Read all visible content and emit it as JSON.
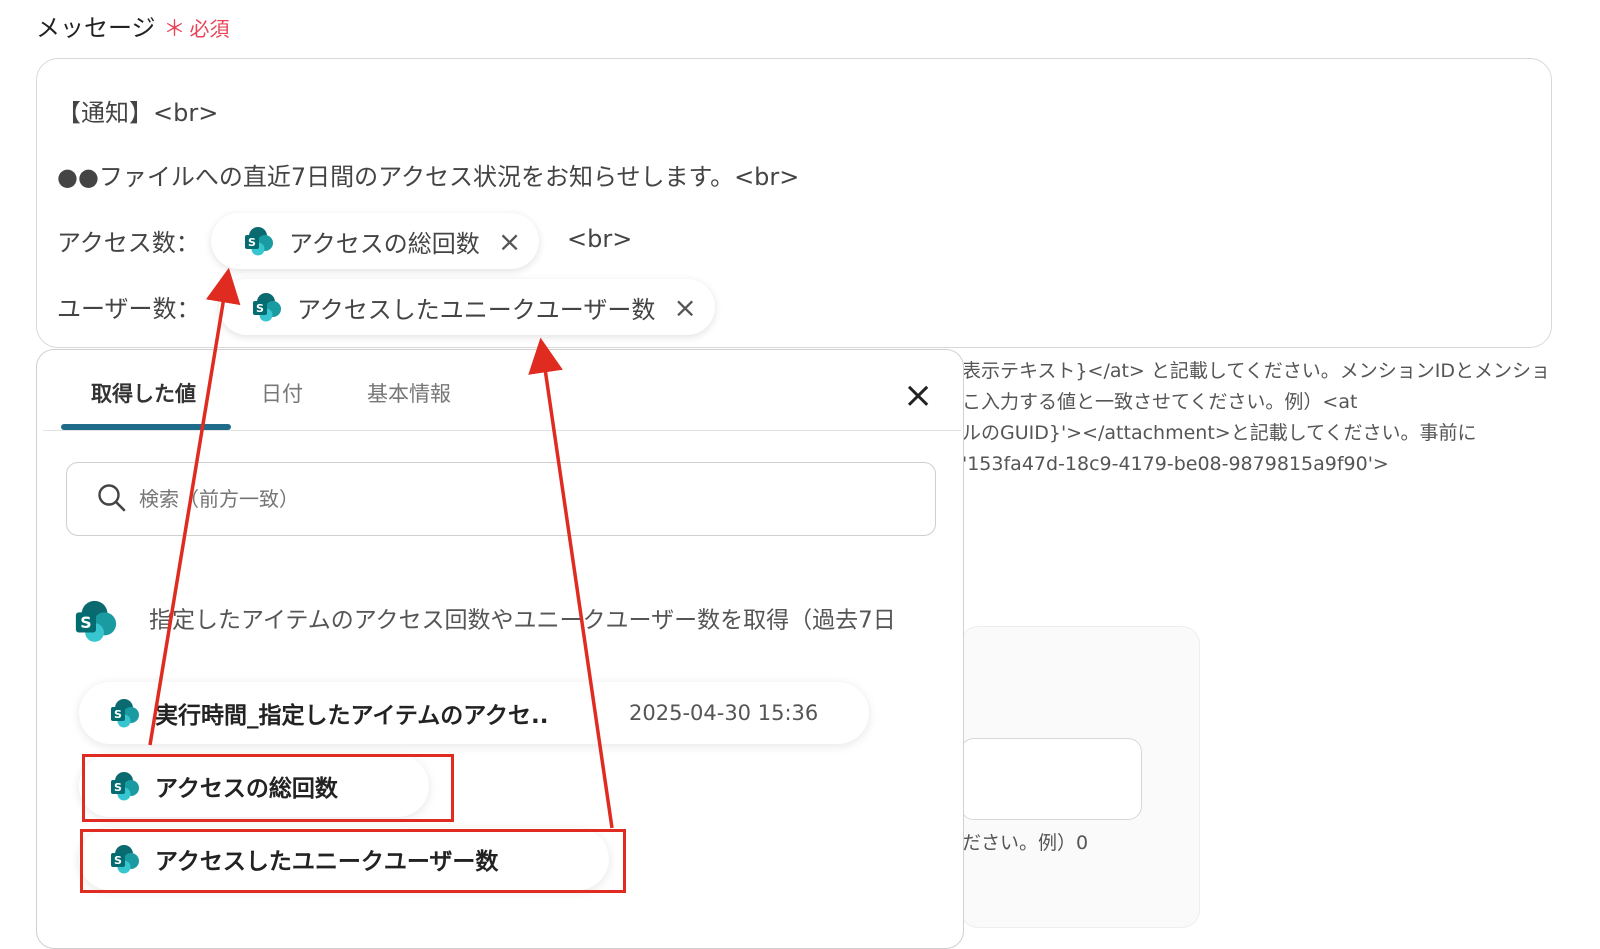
{
  "field": {
    "label": "メッセージ",
    "required_mark": "＊",
    "required_text": "必須"
  },
  "editor": {
    "line1": "【通知】<br>",
    "line2": "●●ファイルへの直近7日間のアクセス状況をお知らせします。<br>",
    "line3_label": "アクセス数：",
    "chip1": "アクセスの総回数",
    "line3_suffix": "<br>",
    "line4_label": "ユーザー数：",
    "chip2": "アクセスしたユニークユーザー数",
    "chip_remove": "×"
  },
  "helper": {
    "line1": "表示テキスト}</at> と記載してください。メンションIDとメンショ",
    "line2": "こ入力する値と一致させてください。例）<at",
    "line3": "ルのGUID}'></attachment>と記載してください。事前に",
    "line4": "'153fa47d-18c9-4179-be08-9879815a9f90'>"
  },
  "background_hint": "ださい。例）0",
  "popup": {
    "tabs": [
      "取得した値",
      "日付",
      "基本情報"
    ],
    "close": "×",
    "search_placeholder": "検索（前方一致）",
    "group_title": "指定したアイテムのアクセス回数やユニークユーザー数を取得（過去7日",
    "items": [
      {
        "label": "実行時間_指定したアイテムのアクセ..",
        "value": "2025-04-30 15:36"
      },
      {
        "label": "アクセスの総回数"
      },
      {
        "label": "アクセスしたユニークユーザー数"
      }
    ]
  },
  "colors": {
    "required": "#e8455a",
    "tab_active": "#1e6c8a",
    "annotation": "#e02b20",
    "sharepoint": "#0f7b83"
  },
  "icons": {
    "chip": "sharepoint-icon",
    "search": "search-icon",
    "close": "close-icon"
  }
}
